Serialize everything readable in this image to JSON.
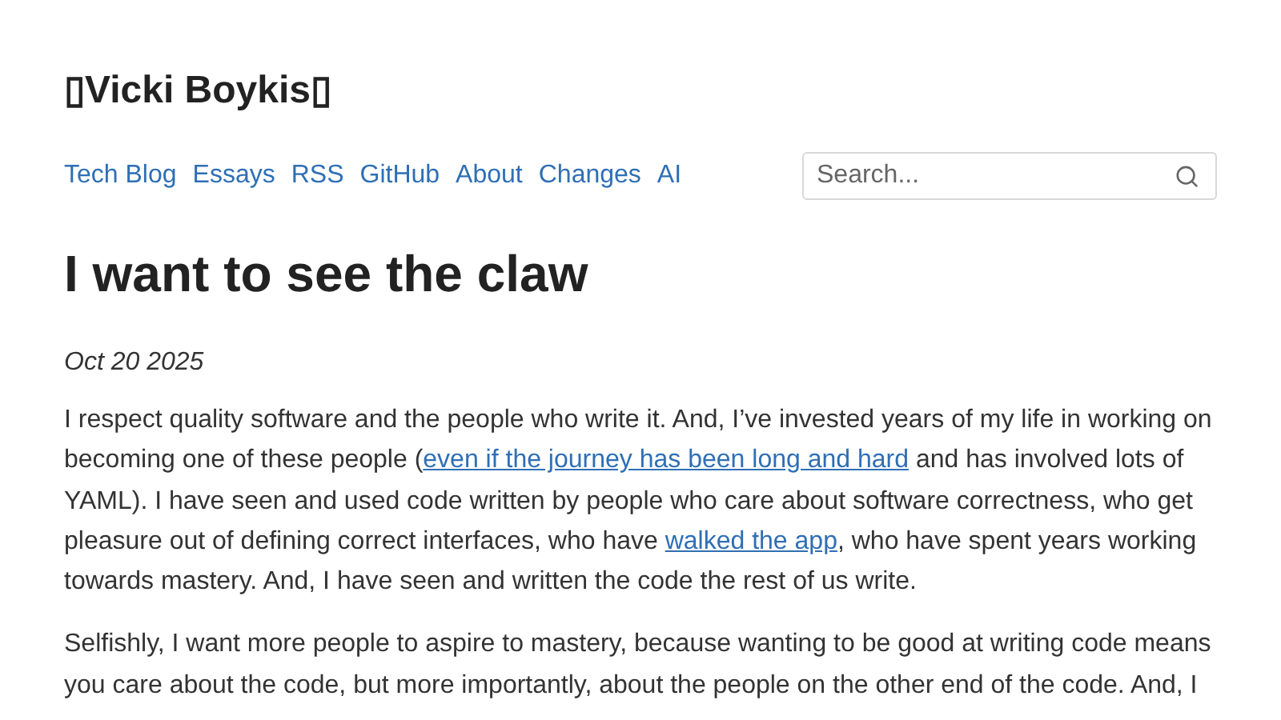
{
  "site_title": "▯Vicki Boykis▯",
  "nav": [
    {
      "label": "Tech Blog"
    },
    {
      "label": "Essays"
    },
    {
      "label": "RSS"
    },
    {
      "label": "GitHub"
    },
    {
      "label": "About"
    },
    {
      "label": "Changes"
    },
    {
      "label": "AI"
    }
  ],
  "search": {
    "placeholder": "Search..."
  },
  "post": {
    "title": "I want to see the claw",
    "date": "Oct 20 2025",
    "paragraphs": [
      [
        {
          "kind": "text",
          "text": "I respect quality software and the people who write it. And, I’ve invested years of my life in working on becoming one of these people ("
        },
        {
          "kind": "link",
          "text": "even if the journey has been long and hard"
        },
        {
          "kind": "text",
          "text": " and has involved lots of YAML). I have seen and used code written by people who care about software correctness, who get pleasure out of defining correct interfaces, who have "
        },
        {
          "kind": "link",
          "text": "walked the app"
        },
        {
          "kind": "text",
          "text": ", who have spent years working towards mastery. And, I have seen and written the code the rest of us write."
        }
      ],
      [
        {
          "kind": "text",
          "text": "Selfishly, I want more people to aspire to mastery, because wanting to be good at writing code means you care about the code, but more importantly, about the people on the other end of the code. And, I"
        }
      ]
    ]
  }
}
